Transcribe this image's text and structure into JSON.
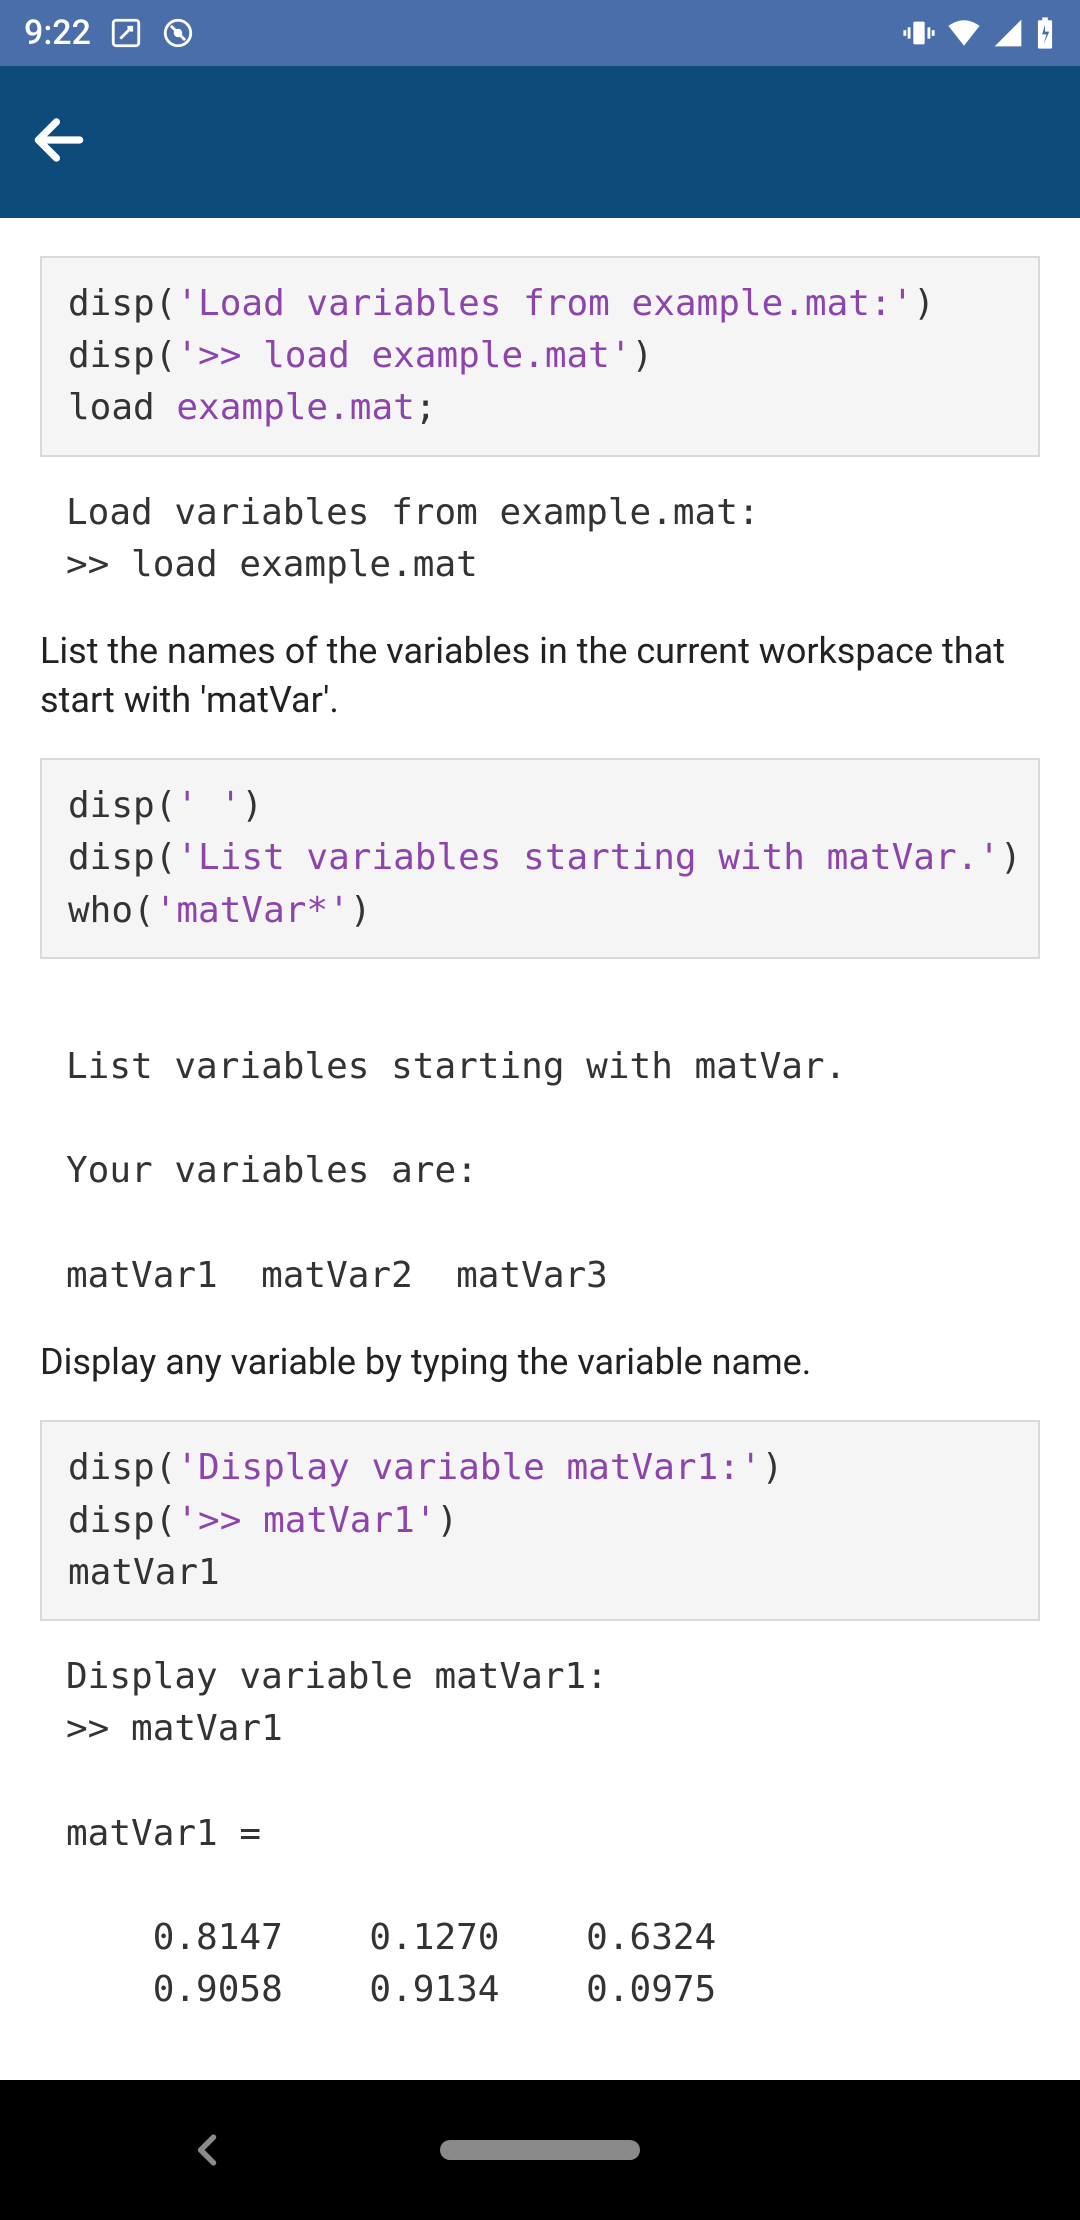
{
  "status": {
    "time": "9:22"
  },
  "code1": {
    "line1a": "disp(",
    "line1b": "'Load variables from example.mat:'",
    "line1c": ")",
    "line2a": "disp(",
    "line2b": "'>> load example.mat'",
    "line2c": ")",
    "line3a": "load ",
    "line3b": "example.mat",
    "line3c": ";"
  },
  "out1": "Load variables from example.mat:\n>> load example.mat",
  "para1": "List the names of the variables in the current workspace that start with 'matVar'.",
  "code2": {
    "line1a": "disp(",
    "line1b": "' '",
    "line1c": ")",
    "line2a": "disp(",
    "line2b": "'List variables starting with matVar.'",
    "line2c": ")",
    "line3a": "who(",
    "line3b": "'matVar*'",
    "line3c": ")"
  },
  "out2": " \nList variables starting with matVar.\n\nYour variables are:\n\nmatVar1  matVar2  matVar3  \n",
  "para2": "Display any variable by typing the variable name.",
  "code3": {
    "line1a": "disp(",
    "line1b": "'Display variable matVar1:'",
    "line1c": ")",
    "line2a": "disp(",
    "line2b": "'>> matVar1'",
    "line2c": ")",
    "line3": "matVar1"
  },
  "out3": "Display variable matVar1:\n>> matVar1\n\nmatVar1 =\n\n    0.8147    0.1270    0.6324\n    0.9058    0.9134    0.0975\n"
}
